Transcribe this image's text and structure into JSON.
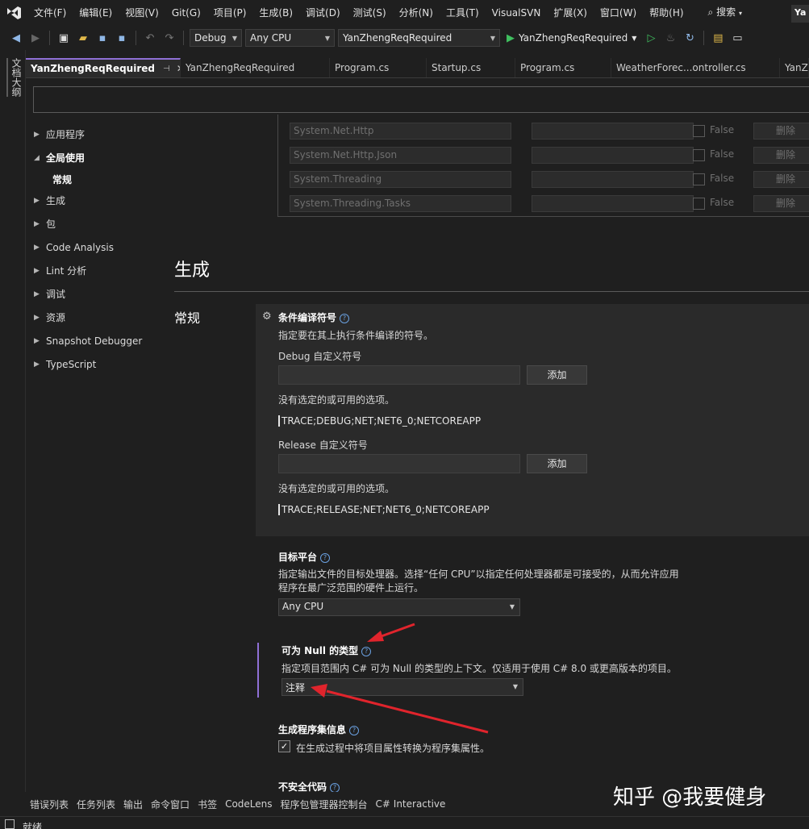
{
  "menu": {
    "items": [
      "文件(F)",
      "编辑(E)",
      "视图(V)",
      "Git(G)",
      "项目(P)",
      "生成(B)",
      "调试(D)",
      "测试(S)",
      "分析(N)",
      "工具(T)",
      "VisualSVN",
      "扩展(X)",
      "窗口(W)",
      "帮助(H)"
    ],
    "search_label": "搜索",
    "title_fragment": "Ya"
  },
  "toolbar": {
    "config": "Debug",
    "platform": "Any CPU",
    "startup_project": "YanZhengReqRequired",
    "run_label": "YanZhengReqRequired"
  },
  "left_strip": {
    "doc_outline": "文档大纲"
  },
  "tabs": [
    {
      "label": "YanZhengReqRequired",
      "active": true
    },
    {
      "label": "YanZhengReqRequired",
      "active": false
    },
    {
      "label": "Program.cs",
      "active": false
    },
    {
      "label": "Startup.cs",
      "active": false
    },
    {
      "label": "Program.cs",
      "active": false
    },
    {
      "label": "WeatherForec...ontroller.cs",
      "active": false
    },
    {
      "label": "YanZh",
      "active": false
    }
  ],
  "nav": {
    "app": "应用程序",
    "global": "全局使用",
    "global_general": "常规",
    "build": "生成",
    "package": "包",
    "code_analysis": "Code Analysis",
    "lint": "Lint 分析",
    "debug": "调试",
    "resources": "资源",
    "snapshot": "Snapshot Debugger",
    "typescript": "TypeScript"
  },
  "namespaces": {
    "rows": [
      {
        "name": "System.Net.Http",
        "value": "False",
        "action": "删除"
      },
      {
        "name": "System.Net.Http.Json",
        "value": "False",
        "action": "删除"
      },
      {
        "name": "System.Threading",
        "value": "False",
        "action": "删除"
      },
      {
        "name": "System.Threading.Tasks",
        "value": "False",
        "action": "删除"
      }
    ]
  },
  "section": {
    "heading": "生成",
    "group": "常规"
  },
  "conditional": {
    "title": "条件编译符号",
    "desc": "指定要在其上执行条件编译的符号。",
    "debug_label": "Debug 自定义符号",
    "add": "添加",
    "no_options": "没有选定的或可用的选项。",
    "debug_value": "TRACE;DEBUG;NET;NET6_0;NETCOREAPP",
    "release_label": "Release 自定义符号",
    "release_value": "TRACE;RELEASE;NET;NET6_0;NETCOREAPP"
  },
  "platform": {
    "title": "目标平台",
    "desc1": "指定输出文件的目标处理器。选择“任何 CPU”以指定任何处理器都是可接受的，从而允许应用",
    "desc2": "程序在最广泛范围的硬件上运行。",
    "value": "Any CPU"
  },
  "nullable": {
    "title": "可为 Null 的类型",
    "desc": "指定项目范围内 C# 可为 Null 的类型的上下文。仅适用于使用 C# 8.0 或更高版本的项目。",
    "value": "注释"
  },
  "assembly_info": {
    "title": "生成程序集信息",
    "checkbox_label": "在生成过程中将项目属性转换为程序集属性。",
    "checked": true
  },
  "unsafe": {
    "title": "不安全代码"
  },
  "bottom_tabs": [
    "错误列表",
    "任务列表",
    "输出",
    "命令窗口",
    "书签",
    "CodeLens",
    "程序包管理器控制台",
    "C# Interactive"
  ],
  "status": {
    "text": "就绪"
  },
  "watermark": "知乎 @我要健身",
  "colors": {
    "accent": "#8f70d6",
    "arrow": "#e0242c",
    "run": "#3fbf5f"
  }
}
